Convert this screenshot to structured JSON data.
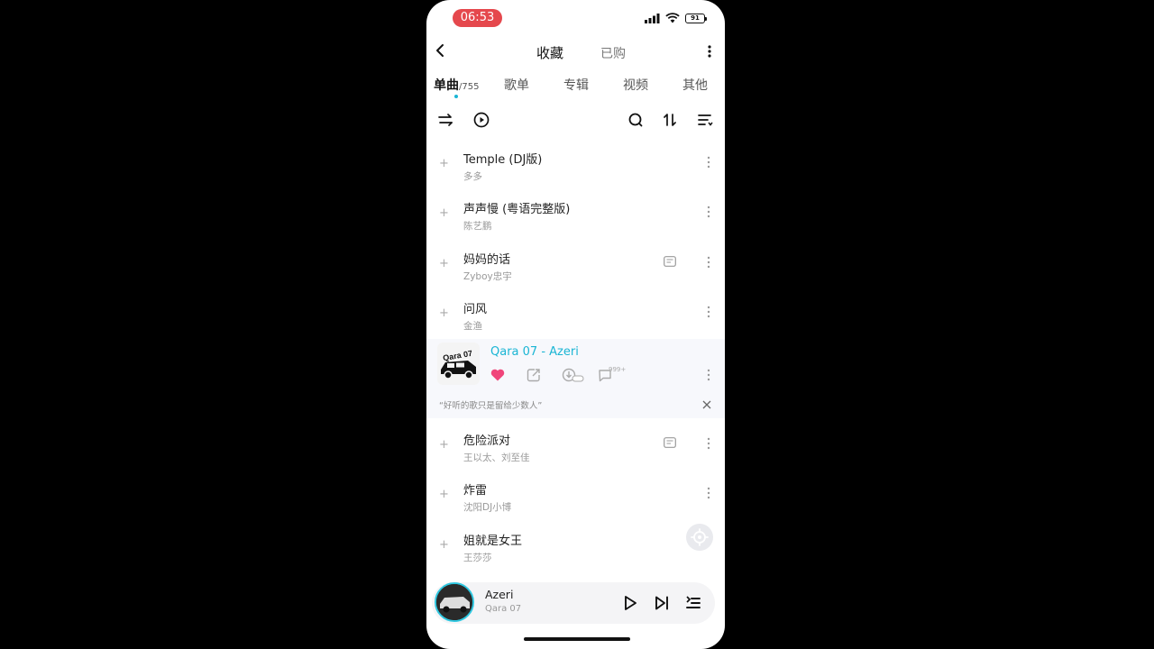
{
  "status": {
    "time": "06:53",
    "battery": "91"
  },
  "nav": {
    "title": "收藏",
    "alt_tab": "已购"
  },
  "tabs": [
    {
      "label": "单曲",
      "count": "/755",
      "active": true
    },
    {
      "label": "歌单"
    },
    {
      "label": "专辑"
    },
    {
      "label": "视频"
    },
    {
      "label": "其他"
    }
  ],
  "songs_top": [
    {
      "title": "Temple (DJ版)",
      "artist": "多多"
    },
    {
      "title": "声声慢 (粤语完整版)",
      "artist": "陈艺鹏"
    },
    {
      "title": "妈妈的话",
      "artist": "Zyboy忠宇",
      "mv": true
    },
    {
      "title": "问风",
      "artist": "金渔"
    }
  ],
  "now_playing": {
    "title": "Qara 07 - Azeri",
    "comment_count": "999+",
    "quote": "“好听的歌只是留给少数人”",
    "cover_text": "Qara 07"
  },
  "songs_bottom": [
    {
      "title": "危险派对",
      "artist": "王以太、刘至佳",
      "mv": true
    },
    {
      "title": "炸雷",
      "artist": "沈阳DJ小博"
    },
    {
      "title": "姐就是女王",
      "artist": "王莎莎"
    }
  ],
  "mini_player": {
    "title": "Azeri",
    "subtitle": "Qara 07"
  },
  "colors": {
    "accent": "#1ab5d4",
    "like": "#f0457a",
    "time_pill": "#e5484d"
  }
}
